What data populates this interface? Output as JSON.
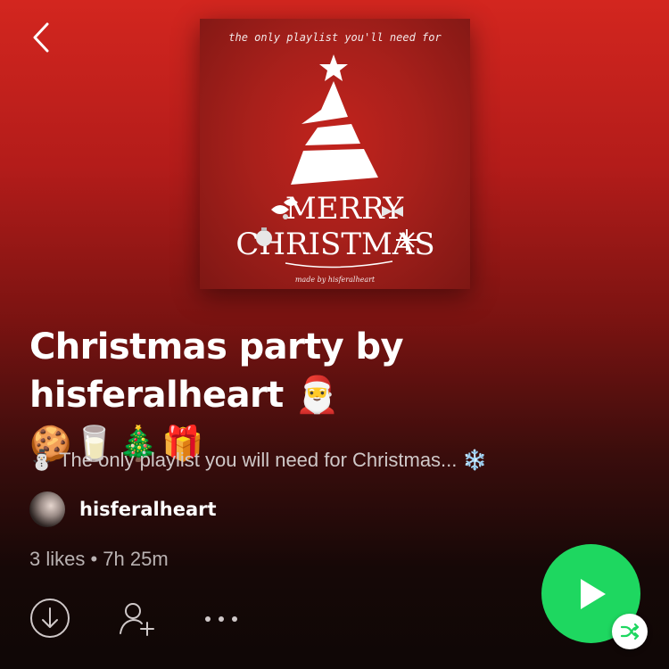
{
  "playlist": {
    "cover": {
      "tagline": "the only playlist you'll need for",
      "headline_line1": "MERRY",
      "headline_line2": "CHRISTMAS",
      "credit": "made by hisferalheart"
    },
    "title": "Christmas party by hisferalheart 🎅",
    "title_emoji": "🍪🥛🎄🎁",
    "description": "⛄ The only playlist you will need for Christmas... ❄️",
    "owner": {
      "name": "hisferalheart"
    },
    "stats": "3 likes • 7h 25m"
  },
  "icons": {
    "back": "back-chevron-icon",
    "download": "download-icon",
    "follow": "add-user-icon",
    "more": "more-dots-icon",
    "play": "play-icon",
    "shuffle": "shuffle-icon"
  },
  "colors": {
    "accent_green": "#1ed760",
    "header_red": "#d3261f",
    "background_dark": "#0f0706",
    "secondary_text": "#b9b2b2"
  }
}
